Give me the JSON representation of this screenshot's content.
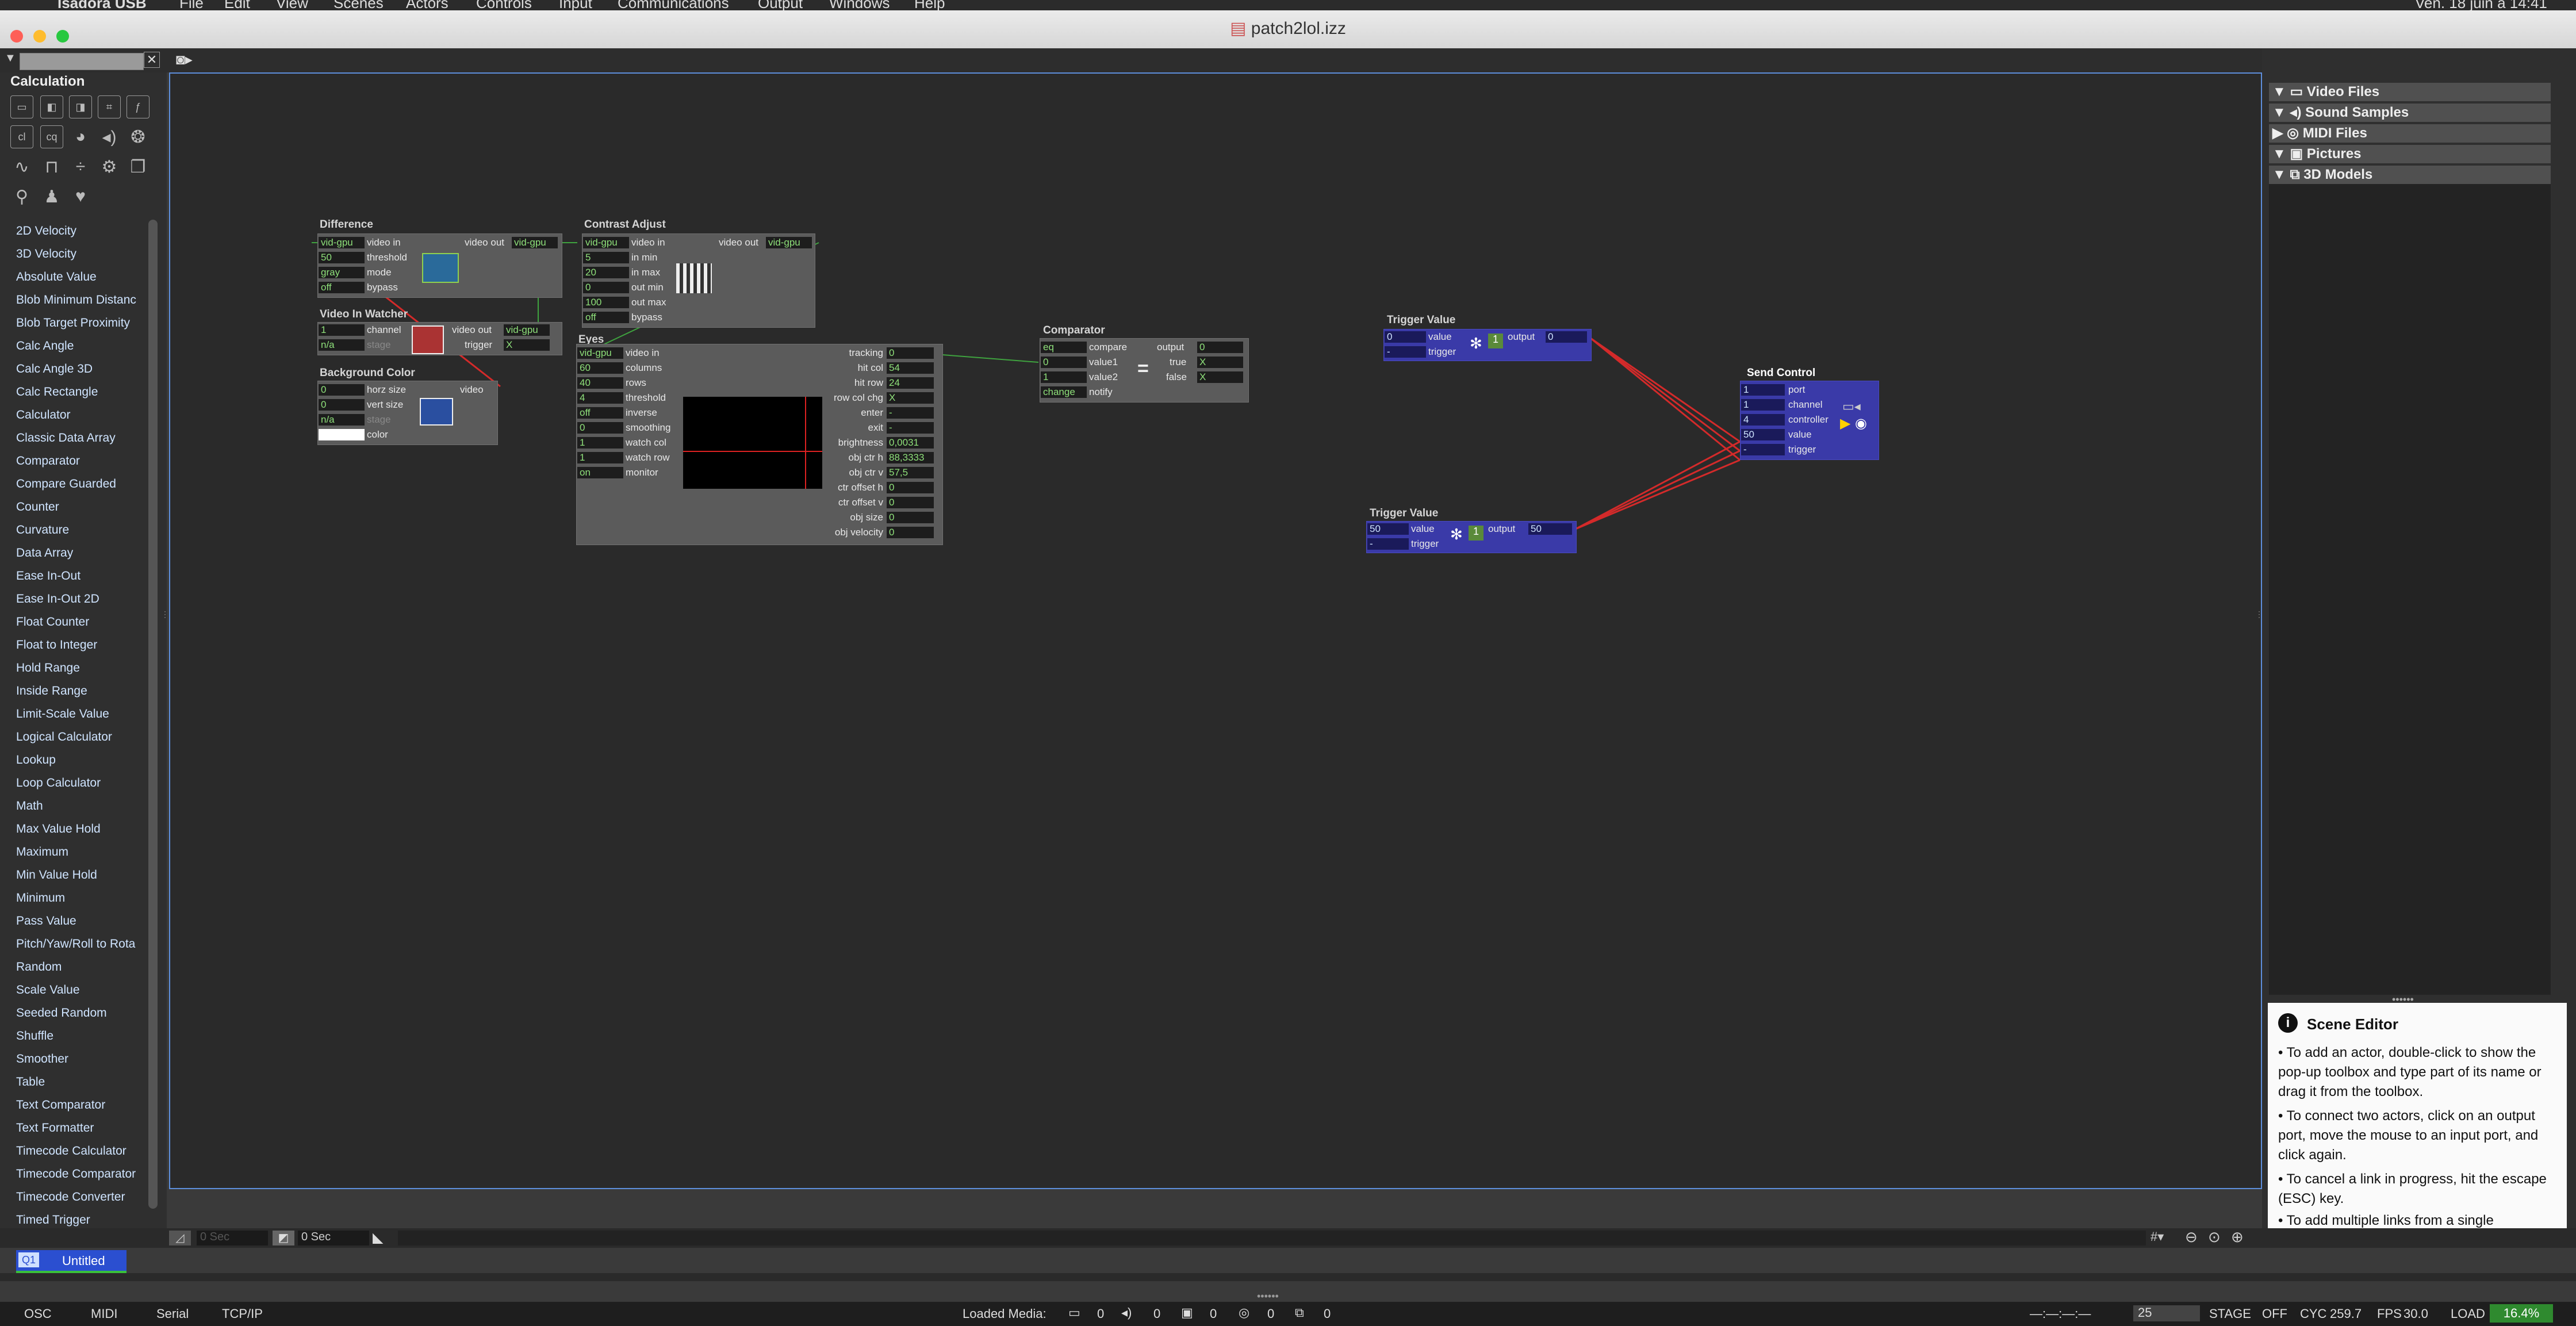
{
  "app": {
    "title": "patch2lol.izz"
  },
  "menubar": {
    "app_name": "Isadora USB",
    "items": [
      "File",
      "Edit",
      "View",
      "Scenes",
      "Actors",
      "Controls",
      "Input",
      "Communications",
      "Output",
      "Windows",
      "Help"
    ],
    "clock": "Ven. 18 juin à 14:41"
  },
  "left_panel": {
    "title": "Calculation",
    "search_placeholder": "",
    "tool_icons": [
      "cl",
      "cq"
    ],
    "actors": [
      "2D Velocity",
      "3D Velocity",
      "Absolute Value",
      "Blob Minimum Distanc",
      "Blob Target Proximity",
      "Calc Angle",
      "Calc Angle 3D",
      "Calc Rectangle",
      "Calculator",
      "Classic Data Array",
      "Comparator",
      "Compare Guarded",
      "Counter",
      "Curvature",
      "Data Array",
      "Ease In-Out",
      "Ease In-Out 2D",
      "Float Counter",
      "Float to Integer",
      "Hold Range",
      "Inside Range",
      "Limit-Scale Value",
      "Logical Calculator",
      "Lookup",
      "Loop Calculator",
      "Math",
      "Max Value Hold",
      "Maximum",
      "Min Value Hold",
      "Minimum",
      "Pass Value",
      "Pitch/Yaw/Roll to Rota",
      "Random",
      "Scale Value",
      "Seeded Random",
      "Shuffle",
      "Smoother",
      "Table",
      "Text Comparator",
      "Text Formatter",
      "Timecode Calculator",
      "Timecode Comparator",
      "Timecode Converter",
      "Timed Trigger"
    ]
  },
  "actors": {
    "difference": {
      "title": "Difference",
      "ports": [
        "video in",
        "threshold",
        "mode",
        "bypass"
      ],
      "values": [
        "vid-gpu",
        "50",
        "gray",
        "off"
      ],
      "out_label": "video out",
      "out_value": "vid-gpu"
    },
    "video_in_watcher": {
      "title": "Video In Watcher",
      "ports": [
        "channel",
        "stage"
      ],
      "values": [
        "1",
        "n/a"
      ],
      "outs": [
        "video out",
        "trigger"
      ],
      "out_values": [
        "vid-gpu",
        "X"
      ]
    },
    "background_color": {
      "title": "Background Color",
      "ports": [
        "horz size",
        "vert size",
        "stage",
        "color"
      ],
      "values": [
        "0",
        "0",
        "n/a",
        ""
      ],
      "out_label": "video"
    },
    "contrast_adjust": {
      "title": "Contrast Adjust",
      "ports": [
        "video in",
        "in min",
        "in max",
        "out min",
        "out max",
        "bypass"
      ],
      "values": [
        "vid-gpu",
        "5",
        "20",
        "0",
        "100",
        "off"
      ],
      "out_label": "video out",
      "out_value": "vid-gpu"
    },
    "eyes": {
      "title": "Eyes",
      "ports": [
        "video in",
        "columns",
        "rows",
        "threshold",
        "inverse",
        "smoothing",
        "watch col",
        "watch row",
        "monitor"
      ],
      "values": [
        "vid-gpu",
        "60",
        "40",
        "4",
        "off",
        "0",
        "1",
        "1",
        "on"
      ],
      "outs": [
        "tracking",
        "hit col",
        "hit row",
        "row col chg",
        "enter",
        "exit",
        "brightness",
        "obj ctr h",
        "obj ctr v",
        "ctr offset h",
        "ctr offset v",
        "obj size",
        "obj velocity"
      ],
      "out_values": [
        "0",
        "54",
        "24",
        "X",
        "-",
        "-",
        "0,0031",
        "88,3333",
        "57,5",
        "0",
        "0",
        "0",
        "0"
      ]
    },
    "comparator": {
      "title": "Comparator",
      "ports": [
        "compare",
        "value1",
        "value2",
        "notify"
      ],
      "values": [
        "eq",
        "0",
        "1",
        "change"
      ],
      "outs": [
        "output",
        "true",
        "false"
      ],
      "out_values": [
        "0",
        "X",
        "X"
      ],
      "symbol": "="
    },
    "trigger_value_1": {
      "title": "Trigger Value",
      "ports": [
        "value",
        "trigger"
      ],
      "values": [
        "0",
        "-"
      ],
      "out_label": "output",
      "out_value": "0"
    },
    "trigger_value_2": {
      "title": "Trigger Value",
      "ports": [
        "value",
        "trigger"
      ],
      "values": [
        "50",
        "-"
      ],
      "out_label": "output",
      "out_value": "50"
    },
    "send_control": {
      "title": "Send Control",
      "ports": [
        "port",
        "channel",
        "controller",
        "value",
        "trigger"
      ],
      "values": [
        "1",
        "1",
        "4",
        "50",
        "-"
      ]
    }
  },
  "right_panel": {
    "media": [
      "Video Files",
      "Sound Samples",
      "MIDI Files",
      "Pictures",
      "3D Models"
    ],
    "scene_editor": {
      "title": "Scene Editor",
      "tips": [
        "• To add an actor, double-click to show the pop-up toolbox and type part of its name or drag it from the toolbox.",
        "• To connect two actors, click on an output port, move the mouse to an input port, and click again.",
        "• To cancel a link in progress, hit the escape (ESC) key.",
        "• To add multiple links from a single"
      ]
    }
  },
  "bottom": {
    "time_left": "0 Sec",
    "time_right": "0 Sec",
    "scene_number": "Q1",
    "scene_name": "Untitled"
  },
  "status": {
    "tabs": [
      "OSC",
      "MIDI",
      "Serial",
      "TCP/IP"
    ],
    "loaded_media_label": "Loaded Media:",
    "media_counts": [
      "0",
      "0",
      "0",
      "0",
      "0"
    ],
    "timecode": "—:—:—:—",
    "stage_value": "25",
    "stage_label": "STAGE",
    "stage_state": "OFF",
    "cyc_label": "CYC",
    "cyc": "259.7",
    "fps_label": "FPS",
    "fps": "30.0",
    "load_label": "LOAD",
    "load": "16.4%"
  },
  "colors": {
    "canvas_border": "#5e8fdc",
    "link_green": "#3fa33f",
    "link_red": "#d42a2a",
    "value_green": "#8ee07a",
    "trigger_blue": "#3a3aa8"
  }
}
